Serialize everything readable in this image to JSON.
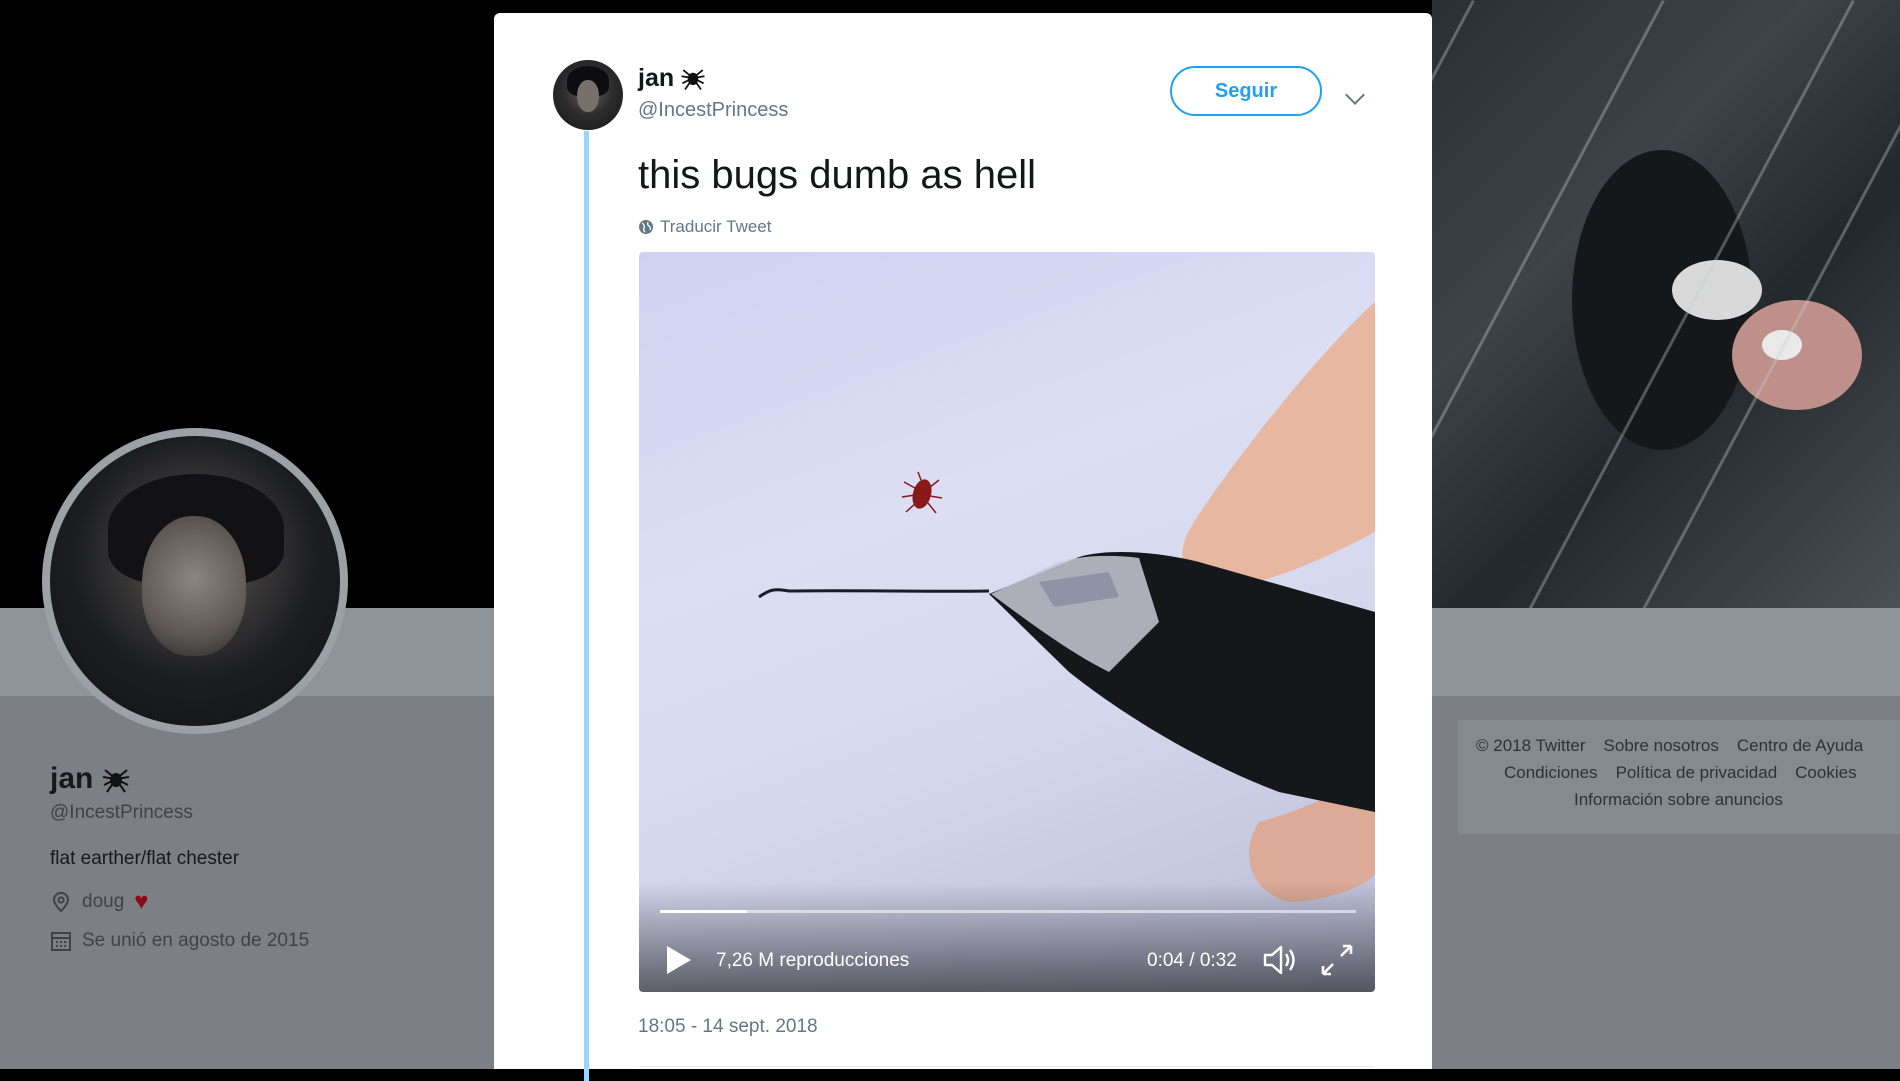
{
  "profile": {
    "name": "jan",
    "handle": "@IncestPrincess",
    "bio": "flat earther/flat chester",
    "location": "doug",
    "joined": "Se unió en agosto de 2015"
  },
  "footer": {
    "row1": [
      "© 2018 Twitter",
      "Sobre nosotros",
      "Centro de Ayuda"
    ],
    "row2": [
      "Condiciones",
      "Política de privacidad",
      "Cookies"
    ],
    "row3": [
      "Información sobre anuncios"
    ]
  },
  "tweet": {
    "name": "jan",
    "handle": "@IncestPrincess",
    "follow_label": "Seguir",
    "text": "this bugs dumb as hell",
    "translate_label": "Traducir Tweet",
    "timestamp": "18:05 - 14 sept. 2018"
  },
  "video": {
    "views": "7,26 M reproducciones",
    "timecode": "0:04 / 0:32",
    "progress": 0.125
  },
  "colors": {
    "accent": "#1da1f2",
    "heart": "#8b0a14",
    "thread_line": "#9fd4f7"
  },
  "icons": [
    "spider-icon",
    "location-pin-icon",
    "heart-icon",
    "calendar-icon",
    "globe-icon",
    "chevron-down-icon",
    "play-icon",
    "volume-icon",
    "fullscreen-icon"
  ]
}
